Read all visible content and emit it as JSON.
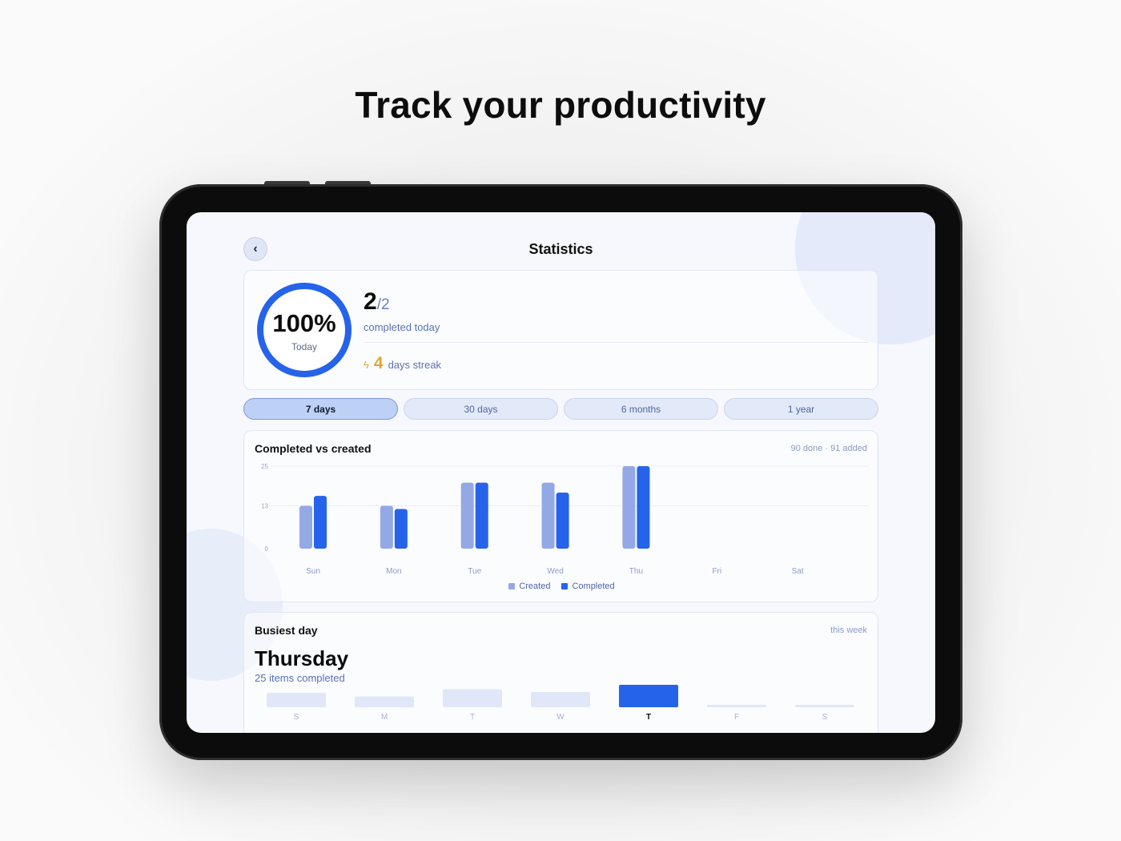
{
  "headline": "Track your productivity",
  "header": {
    "title": "Statistics",
    "back_icon": "chevron-left-icon"
  },
  "summary": {
    "percent_label": "100%",
    "percent_value": 1.0,
    "ring_caption": "Today",
    "completed": "2",
    "total": "/2",
    "completed_label": "completed today",
    "streak_icon": "lightning-bolt-icon",
    "streak_count": "4",
    "streak_label": "days streak"
  },
  "tabs": [
    {
      "label": "7 days",
      "active": true
    },
    {
      "label": "30 days",
      "active": false
    },
    {
      "label": "6 months",
      "active": false
    },
    {
      "label": "1 year",
      "active": false
    }
  ],
  "colors": {
    "accent": "#2563eb",
    "created": "#93a9e6",
    "streak": "#e3a43a",
    "muted_bar": "#dfe7f8"
  },
  "chart_data": [
    {
      "type": "bar",
      "title": "Completed vs created",
      "meta": "90 done · 91 added",
      "categories": [
        "Sun",
        "Mon",
        "Tue",
        "Wed",
        "Thu",
        "Fri",
        "Sat"
      ],
      "series": [
        {
          "name": "Created",
          "values": [
            13,
            13,
            20,
            20,
            25,
            0,
            0
          ]
        },
        {
          "name": "Completed",
          "values": [
            16,
            12,
            20,
            17,
            25,
            0,
            0
          ]
        }
      ],
      "yticks": [
        "25",
        "13",
        "0"
      ],
      "ylim": [
        0,
        25
      ],
      "grid": true,
      "legend": "bottom-center"
    },
    {
      "type": "bar",
      "title": "Busiest day",
      "meta": "this week",
      "categories": [
        "S",
        "M",
        "T",
        "W",
        "T",
        "F",
        "S"
      ],
      "values": [
        16,
        12,
        20,
        17,
        25,
        0,
        0
      ],
      "highlight_index": 4,
      "busiest_day": "Thursday",
      "busiest_summary": "25 items completed"
    }
  ]
}
